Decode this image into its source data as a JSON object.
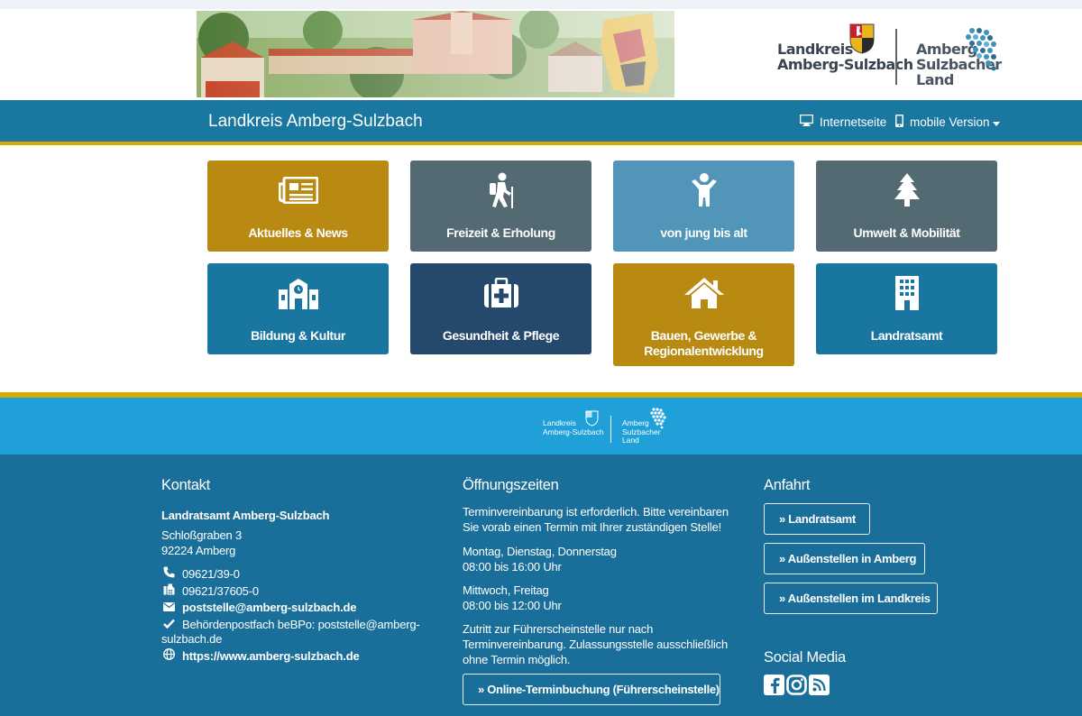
{
  "banner": {
    "landkreis_line1": "Landkreis",
    "landkreis_line2": "Amberg-Sulzbach",
    "amberg_line1": "Amberg",
    "amberg_line2": "Sulzbacher",
    "amberg_line3": "Land"
  },
  "navbar": {
    "site_title": "Landkreis Amberg-Sulzbach",
    "internet_label": "Internetseite",
    "mobile_label": "mobile Version"
  },
  "tiles": [
    {
      "label": "Aktuelles & News",
      "color": "#b98a12",
      "icon": "newspaper-icon"
    },
    {
      "label": "Freizeit & Erholung",
      "color": "#546a72",
      "icon": "hiker-icon"
    },
    {
      "label": "von jung bis alt",
      "color": "#5196b8",
      "icon": "child-icon"
    },
    {
      "label": "Umwelt & Mobilität",
      "color": "#546a72",
      "icon": "tree-icon"
    },
    {
      "label": "Bildung & Kultur",
      "color": "#1876a0",
      "icon": "school-icon"
    },
    {
      "label": "Gesundheit & Pflege",
      "color": "#24496c",
      "icon": "medical-kit-icon"
    },
    {
      "label_line1": "Bauen, Gewerbe &",
      "label_line2": "Regionalentwicklung",
      "color": "#b98a12",
      "icon": "house-icon"
    },
    {
      "label": "Landratsamt",
      "color": "#1876a0",
      "icon": "building-icon"
    }
  ],
  "footer_logo": {
    "landkreis_line1": "Landkreis",
    "landkreis_line2": "Amberg-Sulzbach",
    "amberg_line1": "Amberg",
    "amberg_line2": "Sulzbacher",
    "amberg_line3": "Land"
  },
  "kontakt": {
    "heading": "Kontakt",
    "org": "Landratsamt Amberg-Sulzbach",
    "street": "Schloßgraben 3",
    "city": "92224 Amberg",
    "phone": "09621/39-0",
    "fax": "09621/37605-0",
    "email": "poststelle@amberg-sulzbach.de",
    "bebpo_line1": "Behördenpostfach beBPo: poststelle@amberg-",
    "bebpo_line2": "sulzbach.de",
    "website": "https://www.amberg-sulzbach.de"
  },
  "oeffnung": {
    "heading": "Öffnungszeiten",
    "p1_line1": "Terminvereinbarung ist erforderlich. Bitte vereinbaren",
    "p1_line2": "Sie vorab einen Termin mit Ihrer zuständigen Stelle!",
    "days1": "Montag, Dienstag, Donnerstag",
    "hours1": "08:00 bis 16:00 Uhr",
    "days2": "Mittwoch, Freitag",
    "hours2": "08:00 bis 12:00 Uhr",
    "p2_line1": "Zutritt zur Führerscheinstelle nur nach",
    "p2_line2": "Terminvereinbarung. Zulassungsstelle ausschließlich",
    "p2_line3": "ohne Termin möglich.",
    "booking_button": "» Online-Terminbuchung (Führerscheinstelle)"
  },
  "anfahrt": {
    "heading": "Anfahrt",
    "btn1": "» Landratsamt",
    "btn2": "» Außenstellen in Amberg",
    "btn3": "» Außenstellen im Landkreis"
  },
  "social": {
    "heading": "Social Media",
    "icons": [
      "facebook-icon",
      "instagram-icon",
      "rss-icon"
    ]
  }
}
